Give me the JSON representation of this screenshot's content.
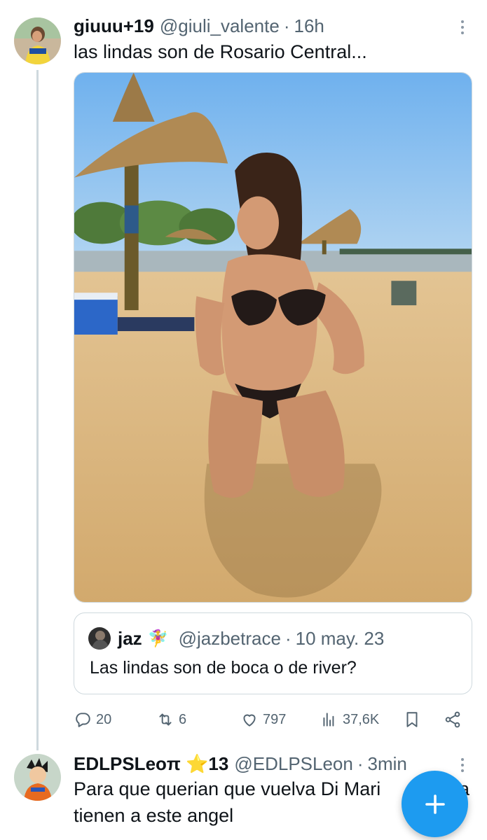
{
  "tweet": {
    "display_name": "giuuu+19",
    "handle": "@giuli_valente",
    "separator": "·",
    "time": "16h",
    "text": "las lindas son de Rosario Central...",
    "media_alt": "photo"
  },
  "quote": {
    "display_name": "jaz",
    "emoji": "🧚‍♀️",
    "handle": "@jazbetrace",
    "separator": "·",
    "date": "10 may. 23",
    "text": "Las lindas son de boca o de river?"
  },
  "actions": {
    "replies": "20",
    "retweets": "6",
    "likes": "797",
    "views": "37,6K"
  },
  "reply": {
    "display_name": "EDLPSLeoπ ⭐13",
    "handle": "@EDLPSLeon",
    "separator": "·",
    "time": "3min",
    "text_line1": "Para que querian que vuelva Di Mari",
    "text_line1_end": "a",
    "text_line2": "tienen a este angel"
  },
  "colors": {
    "accent": "#1d9bf0",
    "secondary_text": "#536471",
    "border": "#cfd9de"
  },
  "icons": [
    "more-icon",
    "reply-icon",
    "retweet-icon",
    "like-icon",
    "views-icon",
    "bookmark-icon",
    "share-icon",
    "compose-icon"
  ]
}
